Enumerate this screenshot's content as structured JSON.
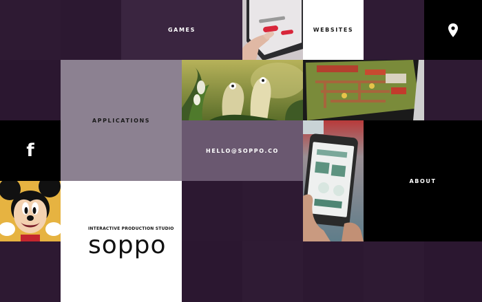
{
  "nav": {
    "games_label": "GAMES",
    "websites_label": "WEBSITES",
    "applications_label": "APPLICATIONS",
    "email_label": "HELLO@SOPPO.CO",
    "about_label": "ABOUT"
  },
  "brand": {
    "tagline": "INTERACTIVE PRODUCTION STUDIO",
    "logo_text": "soppo"
  },
  "icons": {
    "location": "map-pin-icon",
    "facebook": "facebook-icon",
    "facebook_glyph": "f"
  },
  "colors": {
    "page_bg": "#2a1630",
    "tile_dark": "#2e1a33",
    "tile_light_purple": "#8c8191",
    "tile_mid_purple": "#6a5870",
    "white": "#ffffff",
    "black": "#000000"
  }
}
